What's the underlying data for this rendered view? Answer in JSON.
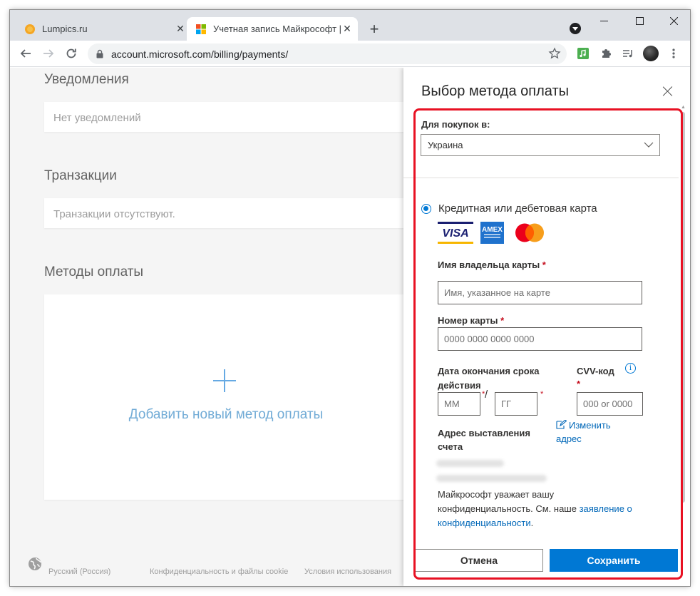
{
  "browser": {
    "tabs": [
      {
        "title": "Lumpics.ru",
        "active": false
      },
      {
        "title": "Учетная запись Майкрософт | с",
        "active": true
      }
    ],
    "url": "account.microsoft.com/billing/payments/"
  },
  "page": {
    "notifications": {
      "title": "Уведомления",
      "empty": "Нет уведомлений"
    },
    "transactions": {
      "title": "Транзакции",
      "empty": "Транзакции отсутствуют."
    },
    "payment_methods": {
      "title": "Методы оплаты",
      "add_label": "Добавить новый метод оплаты"
    },
    "footer": {
      "language": "Русский (Россия)",
      "privacy": "Конфиденциальность и файлы cookie",
      "terms": "Условия использования"
    }
  },
  "panel": {
    "title": "Выбор метода оплаты",
    "purchase_region_label": "Для покупок в:",
    "purchase_region_value": "Украина",
    "payment_option_label": "Кредитная или дебетовая карта",
    "card_brands": [
      "VISA",
      "AMEX",
      "Mastercard"
    ],
    "cardholder": {
      "label": "Имя владельца карты",
      "required": "*",
      "placeholder": "Имя, указанное на карте"
    },
    "card_number": {
      "label": "Номер карты",
      "required": "*",
      "placeholder": "0000 0000 0000 0000"
    },
    "expiry": {
      "label_line1": "Дата окончания срока",
      "label_line2": "действия",
      "month_placeholder": "ММ",
      "year_placeholder": "ГГ",
      "separator": "/",
      "required": "*"
    },
    "cvv": {
      "label": "CVV-код",
      "required": "*",
      "placeholder": "000 or 0000"
    },
    "billing_address": {
      "label_line1": "Адрес выставления",
      "label_line2": "счета",
      "change_line1": "Изменить",
      "change_line2": "адрес"
    },
    "privacy": {
      "text": "Майкрософт уважает вашу конфиденциальность. См. наше ",
      "link_line1": "заявление о",
      "link_line2": "конфиденциальности",
      "end": "."
    },
    "cancel_button": "Отмена",
    "save_button": "Сохранить"
  },
  "colors": {
    "accent": "#0078d4",
    "link": "#0067b8",
    "annotation": "#e81123",
    "mastercard_red": "#eb001b",
    "mastercard_orange": "#f79e1b"
  }
}
